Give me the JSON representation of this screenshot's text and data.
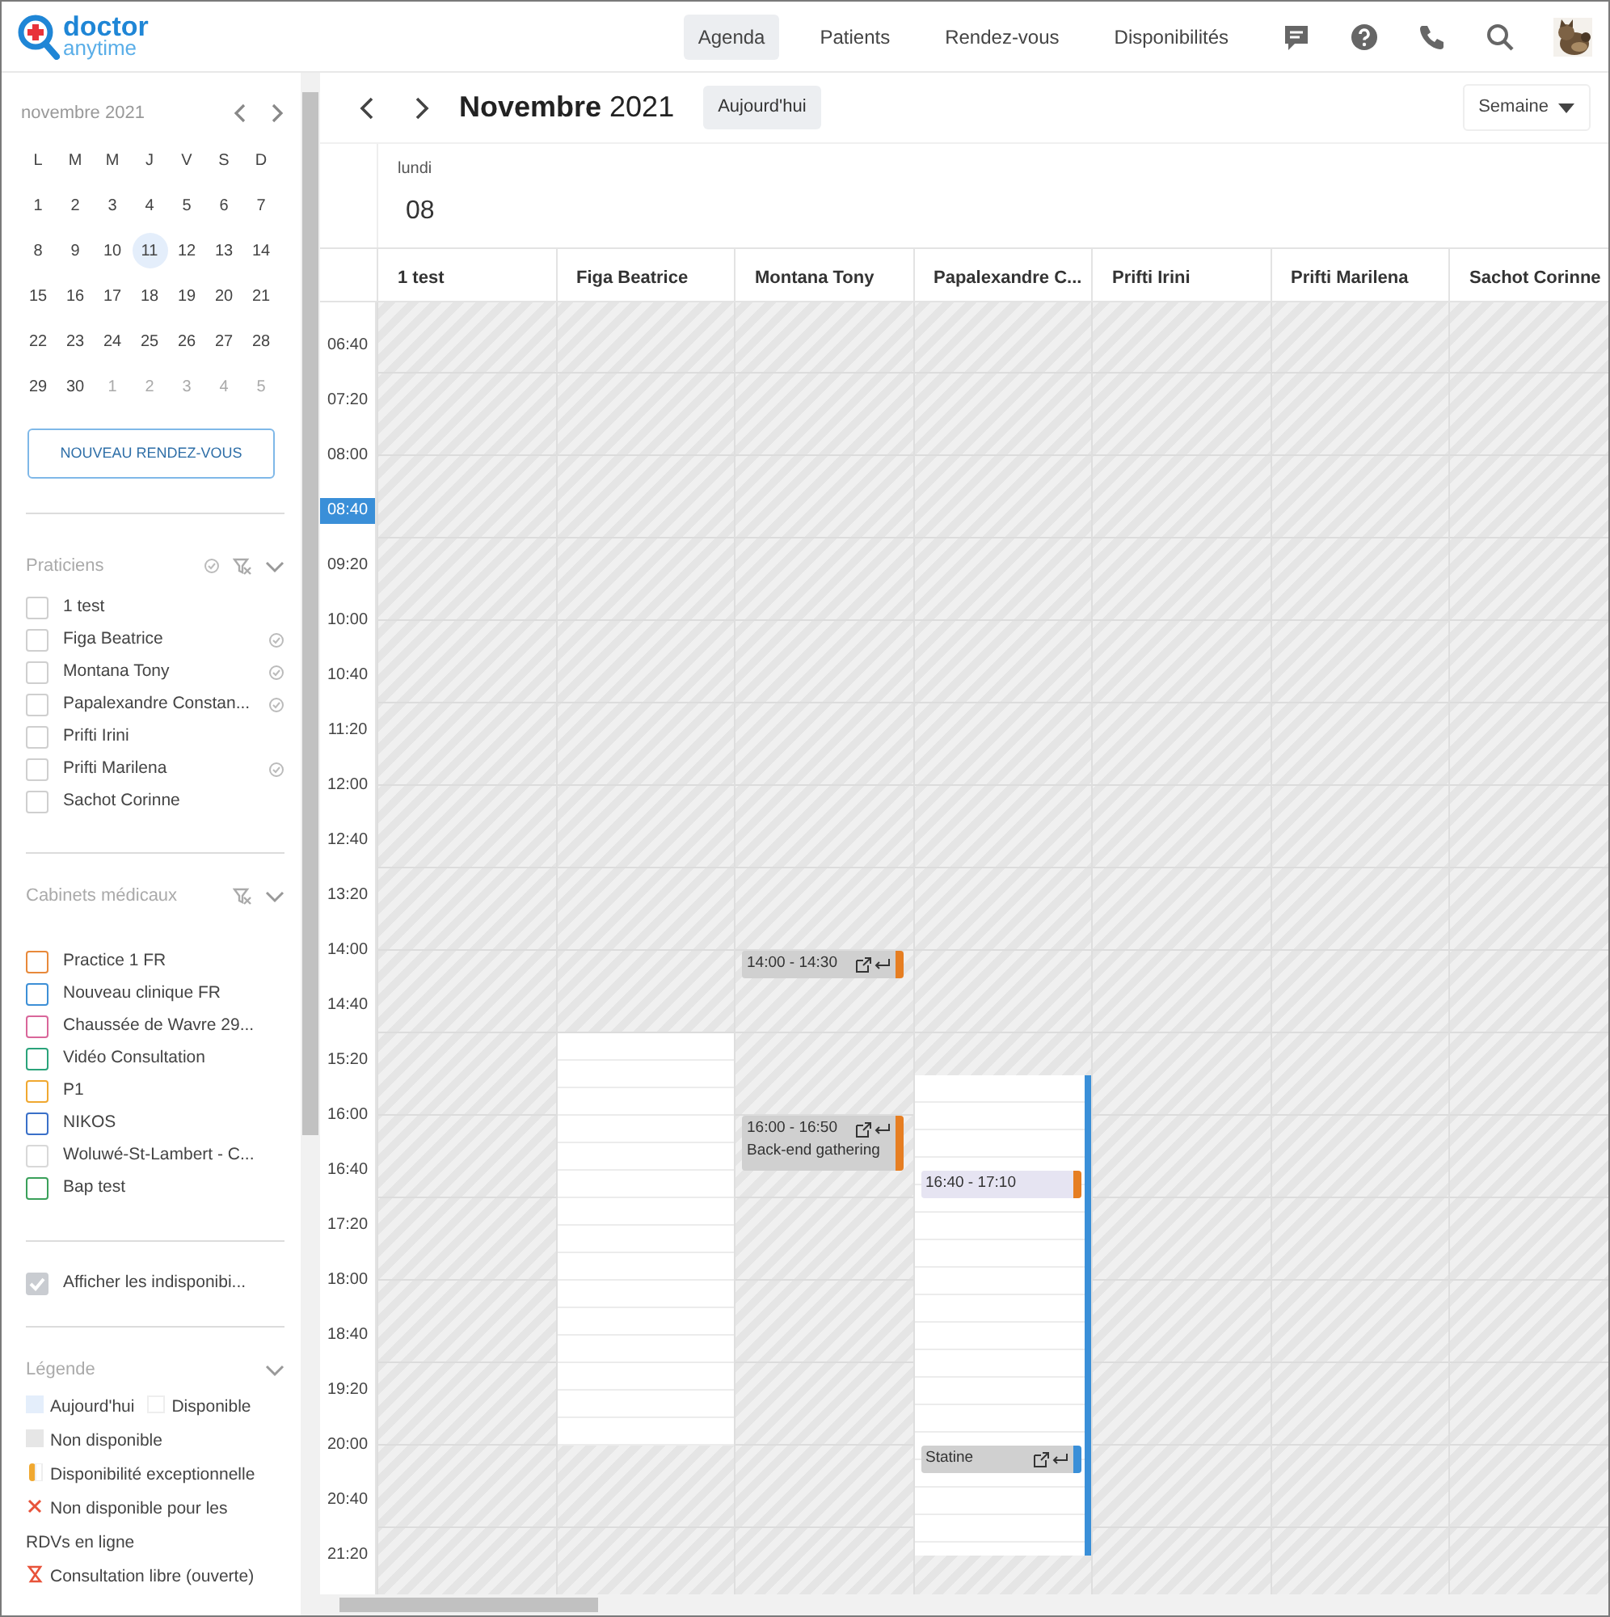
{
  "logo": {
    "line1": "doctor",
    "line2": "anytime"
  },
  "nav": [
    {
      "label": "Agenda",
      "selected": true
    },
    {
      "label": "Patients",
      "selected": false
    },
    {
      "label": "Rendez-vous",
      "selected": false
    },
    {
      "label": "Disponibilités",
      "selected": false
    }
  ],
  "mini_calendar": {
    "title": "novembre 2021",
    "weekdays": [
      "L",
      "M",
      "M",
      "J",
      "V",
      "S",
      "D"
    ],
    "weeks": [
      [
        {
          "text": "1",
          "today": false,
          "outside": false
        },
        {
          "text": "2",
          "today": false,
          "outside": false
        },
        {
          "text": "3",
          "today": false,
          "outside": false
        },
        {
          "text": "4",
          "today": false,
          "outside": false
        },
        {
          "text": "5",
          "today": false,
          "outside": false
        },
        {
          "text": "6",
          "today": false,
          "outside": false
        },
        {
          "text": "7",
          "today": false,
          "outside": false
        }
      ],
      [
        {
          "text": "8",
          "today": false,
          "outside": false
        },
        {
          "text": "9",
          "today": false,
          "outside": false
        },
        {
          "text": "10",
          "today": false,
          "outside": false
        },
        {
          "text": "11",
          "today": true,
          "outside": false
        },
        {
          "text": "12",
          "today": false,
          "outside": false
        },
        {
          "text": "13",
          "today": false,
          "outside": false
        },
        {
          "text": "14",
          "today": false,
          "outside": false
        }
      ],
      [
        {
          "text": "15",
          "today": false,
          "outside": false
        },
        {
          "text": "16",
          "today": false,
          "outside": false
        },
        {
          "text": "17",
          "today": false,
          "outside": false
        },
        {
          "text": "18",
          "today": false,
          "outside": false
        },
        {
          "text": "19",
          "today": false,
          "outside": false
        },
        {
          "text": "20",
          "today": false,
          "outside": false
        },
        {
          "text": "21",
          "today": false,
          "outside": false
        }
      ],
      [
        {
          "text": "22",
          "today": false,
          "outside": false
        },
        {
          "text": "23",
          "today": false,
          "outside": false
        },
        {
          "text": "24",
          "today": false,
          "outside": false
        },
        {
          "text": "25",
          "today": false,
          "outside": false
        },
        {
          "text": "26",
          "today": false,
          "outside": false
        },
        {
          "text": "27",
          "today": false,
          "outside": false
        },
        {
          "text": "28",
          "today": false,
          "outside": false
        }
      ],
      [
        {
          "text": "29",
          "today": false,
          "outside": false
        },
        {
          "text": "30",
          "today": false,
          "outside": false
        },
        {
          "text": "1",
          "today": false,
          "outside": true
        },
        {
          "text": "2",
          "today": false,
          "outside": true
        },
        {
          "text": "3",
          "today": false,
          "outside": true
        },
        {
          "text": "4",
          "today": false,
          "outside": true
        },
        {
          "text": "5",
          "today": false,
          "outside": true
        }
      ]
    ]
  },
  "new_appointment_button": "NOUVEAU RENDEZ-VOUS",
  "praticiens": {
    "title": "Praticiens",
    "items": [
      {
        "name": "1 test",
        "checked": false,
        "availability_icon": false
      },
      {
        "name": "Figa Beatrice",
        "checked": false,
        "availability_icon": true
      },
      {
        "name": "Montana Tony",
        "checked": false,
        "availability_icon": true
      },
      {
        "name": "Papalexandre Constan...",
        "checked": false,
        "availability_icon": true
      },
      {
        "name": "Prifti Irini",
        "checked": false,
        "availability_icon": false
      },
      {
        "name": "Prifti Marilena",
        "checked": false,
        "availability_icon": true
      },
      {
        "name": "Sachot Corinne",
        "checked": false,
        "availability_icon": false
      }
    ]
  },
  "cabinets": {
    "title": "Cabinets médicaux",
    "items": [
      {
        "name": "Practice 1 FR",
        "checked": false,
        "color": "#e8893a"
      },
      {
        "name": "Nouveau clinique FR",
        "checked": false,
        "color": "#3d8fd6"
      },
      {
        "name": "Chaussée de Wavre 29...",
        "checked": false,
        "color": "#d9669a"
      },
      {
        "name": "Vidéo Consultation",
        "checked": false,
        "color": "#2aa37a"
      },
      {
        "name": "P1",
        "checked": false,
        "color": "#f0a830"
      },
      {
        "name": "NIKOS",
        "checked": false,
        "color": "#3a70c8"
      },
      {
        "name": "Woluwé-St-Lambert - C...",
        "checked": false,
        "color": "#d8d8d8"
      },
      {
        "name": "Bap test",
        "checked": false,
        "color": "#3aa05a"
      }
    ]
  },
  "show_unavailable": {
    "label": "Afficher les indisponibi...",
    "checked": true
  },
  "legend": {
    "title": "Légende",
    "items": [
      {
        "label": "Aujourd'hui",
        "kind": "today"
      },
      {
        "label": "Disponible",
        "kind": "available"
      },
      {
        "label": "Non disponible",
        "kind": "unavailable"
      },
      {
        "label": "Disponibilité exceptionnelle",
        "kind": "exceptional"
      },
      {
        "label": "Non disponible pour les RDVs en ligne",
        "kind": "offline"
      },
      {
        "label": "Consultation libre (ouverte)",
        "kind": "open"
      }
    ]
  },
  "toolbar": {
    "title": "**Novembre** 2021",
    "today_button": "Aujourd'hui",
    "view": "Semaine"
  },
  "day": {
    "weekday": "lundi",
    "date": "08"
  },
  "time_labels": [
    {
      "text": "06:40",
      "current": false
    },
    {
      "text": "07:20",
      "current": false
    },
    {
      "text": "08:00",
      "current": false
    },
    {
      "text": "08:40",
      "current": true
    },
    {
      "text": "09:20",
      "current": false
    },
    {
      "text": "10:00",
      "current": false
    },
    {
      "text": "10:40",
      "current": false
    },
    {
      "text": "11:20",
      "current": false
    },
    {
      "text": "12:00",
      "current": false
    },
    {
      "text": "12:40",
      "current": false
    },
    {
      "text": "13:20",
      "current": false
    },
    {
      "text": "14:00",
      "current": false
    },
    {
      "text": "14:40",
      "current": false
    },
    {
      "text": "15:20",
      "current": false
    },
    {
      "text": "16:00",
      "current": false
    },
    {
      "text": "16:40",
      "current": false
    },
    {
      "text": "17:20",
      "current": false
    },
    {
      "text": "18:00",
      "current": false
    },
    {
      "text": "18:40",
      "current": false
    },
    {
      "text": "19:20",
      "current": false
    },
    {
      "text": "20:00",
      "current": false
    },
    {
      "text": "20:40",
      "current": false
    },
    {
      "text": "21:20",
      "current": false
    }
  ],
  "columns": [
    {
      "name": "1 test"
    },
    {
      "name": "Figa Beatrice",
      "available": [
        {
          "edge_bar": false
        }
      ]
    },
    {
      "name": "Montana Tony",
      "events": [
        {
          "time": "14:00 - 14:30",
          "kind": "external",
          "color": "#e67e22"
        },
        {
          "time": "16:00 - 16:50",
          "title": "Back-end gathering",
          "kind": "external",
          "color": "#e67e22"
        }
      ]
    },
    {
      "name": "Papalexandre C...",
      "available": [
        {
          "edge_bar": true
        }
      ],
      "events": [
        {
          "time": "16:40 - 17:10",
          "kind": "appointment",
          "color": "#e67e22"
        },
        {
          "title": "Statine",
          "kind": "external",
          "color": "#3a8fd8"
        }
      ]
    },
    {
      "name": "Prifti Irini"
    },
    {
      "name": "Prifti Marilena"
    },
    {
      "name": "Sachot Corinne"
    }
  ]
}
